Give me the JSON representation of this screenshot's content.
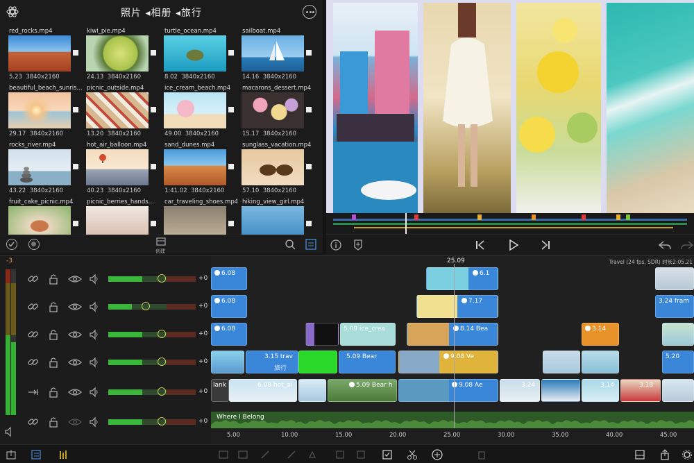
{
  "browser": {
    "title": "照片 ◂相册 ◂旅行",
    "footer_create_label": "创建",
    "clips": [
      {
        "name": "red_rocks.mp4",
        "duration": "5.23",
        "resolution": "3840x2160",
        "thumb": "red-rocks"
      },
      {
        "name": "kiwi_pie.mp4",
        "duration": "24.13",
        "resolution": "3840x2160",
        "thumb": "kiwi-pie"
      },
      {
        "name": "turtle_ocean.mp4",
        "duration": "8.02",
        "resolution": "3840x2160",
        "thumb": "turtle-ocean"
      },
      {
        "name": "sailboat.mp4",
        "duration": "14.16",
        "resolution": "3840x2160",
        "thumb": "sailboat"
      },
      {
        "name": "beautiful_beach_sunris...",
        "duration": "29.17",
        "resolution": "3840x2160",
        "thumb": "beach-sunrise"
      },
      {
        "name": "picnic_outside.mp4",
        "duration": "13.20",
        "resolution": "3840x2160",
        "thumb": "picnic"
      },
      {
        "name": "ice_cream_beach.mp4",
        "duration": "49.00",
        "resolution": "3840x2160",
        "thumb": "ice-cream"
      },
      {
        "name": "macarons_dessert.mp4",
        "duration": "15.17",
        "resolution": "3840x2160",
        "thumb": "macarons"
      },
      {
        "name": "rocks_river.mp4",
        "duration": "43.22",
        "resolution": "3840x2160",
        "thumb": "rocks-river"
      },
      {
        "name": "hot_air_balloon.mp4",
        "duration": "40.23",
        "resolution": "3840x2160",
        "thumb": "balloon"
      },
      {
        "name": "sand_dunes.mp4",
        "duration": "1:41.02",
        "resolution": "3840x2160",
        "thumb": "dunes"
      },
      {
        "name": "sunglass_vacation.mp4",
        "duration": "57.10",
        "resolution": "3840x2160",
        "thumb": "sunglasses"
      },
      {
        "name": "fruit_cake_picnic.mp4",
        "duration": "",
        "resolution": "",
        "thumb": "fruit-cake"
      },
      {
        "name": "picnic_berries_hands...",
        "duration": "",
        "resolution": "",
        "thumb": "berries"
      },
      {
        "name": "car_traveling_shoes.mp4",
        "duration": "",
        "resolution": "",
        "thumb": "shoes"
      },
      {
        "name": "hiking_view_girl.mp4",
        "duration": "",
        "resolution": "",
        "thumb": "hiking"
      }
    ]
  },
  "timeline": {
    "playhead_time": "25.09",
    "project_info": "Travel (24 fps, SDR) 时长2:05.21",
    "meter_label": "-3",
    "gain_label": "+0",
    "track_volume_levels": [
      0.58,
      0.4,
      0.58,
      0.58,
      0.58,
      0.58
    ],
    "audio_title": "Where I Belong",
    "ruler_ticks": [
      "5.00",
      "10.00",
      "15.00",
      "20.00",
      "25.00",
      "30.00",
      "35.00",
      "40.00",
      "45.00"
    ],
    "clip_labels": {
      "c1": "6.08",
      "c2": "6.08",
      "c3": "6.08",
      "c4": "6.1",
      "c5": "7.17",
      "c6": "8.14  Bea",
      "c7": "3.14",
      "c8": "3.15  trav",
      "c8_sub": "旅行",
      "c9": "5.09  Bear",
      "c10": "9.08  Ve",
      "c11": "lank",
      "c12": "6.08  hot_ai",
      "c13": "5.09  Bear h",
      "c14": "9.08  Ae",
      "c15": "3.24",
      "c16": "3.14",
      "c17": "3.18",
      "c18": "5.09  ice_crea",
      "c19": "3.24  fram",
      "c20": "5.20",
      "c21": "3.14"
    }
  },
  "colors": {
    "clip_blue": "#3a86d8",
    "clip_orange": "#e8922a",
    "clip_yellow": "#e0b43a",
    "audio_green": "#2e5a28",
    "meter_green": "#35b035",
    "meter_amber": "#e5a040"
  }
}
